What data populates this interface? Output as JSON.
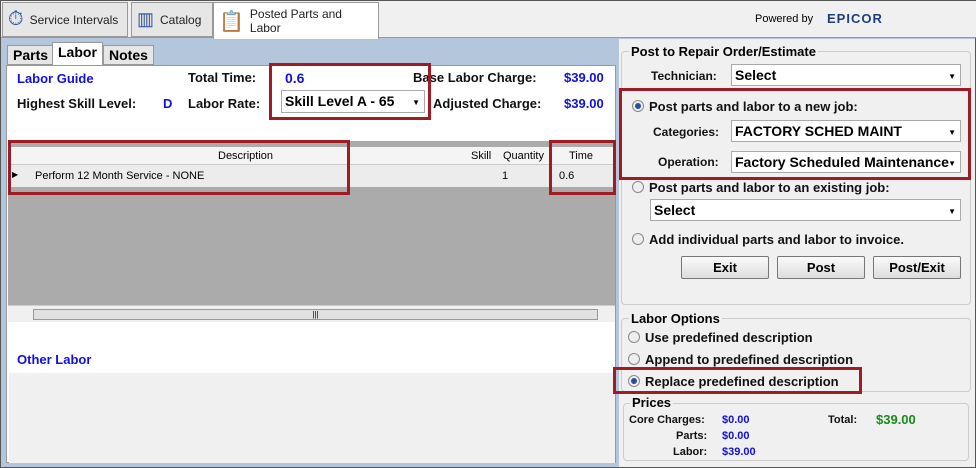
{
  "top_tabs": [
    {
      "label": "Service Intervals",
      "icon": "wrench-clock-icon"
    },
    {
      "label": "Catalog",
      "icon": "binders-icon"
    },
    {
      "label": "Posted Parts and Labor",
      "icon": "clipboard-icon"
    }
  ],
  "powered_by": "Powered by",
  "brand": "EPICOR",
  "sub_tabs": [
    "Parts",
    "Labor",
    "Notes"
  ],
  "labor": {
    "labor_guide": "Labor Guide",
    "total_time_label": "Total Time:",
    "total_time": "0.6",
    "base_charge_label": "Base Labor Charge:",
    "base_charge": "$39.00",
    "highest_skill_label": "Highest Skill Level:",
    "highest_skill": "D",
    "labor_rate_label": "Labor Rate:",
    "labor_rate": "Skill Level A - 65",
    "adjusted_label": "Adjusted Charge:",
    "adjusted": "$39.00"
  },
  "grid": {
    "columns": [
      "Description",
      "Skill",
      "Quantity",
      "Time"
    ],
    "rows": [
      {
        "description": "Perform 12 Month Service - NONE",
        "skill": "",
        "quantity": "1",
        "time": "0.6"
      }
    ]
  },
  "other_labor": "Other Labor",
  "post": {
    "title": "Post to Repair Order/Estimate",
    "technician_label": "Technician:",
    "technician": "Select",
    "new_job": "Post parts and labor to a new job:",
    "categories_label": "Categories:",
    "categories": "FACTORY SCHED MAINT",
    "operation_label": "Operation:",
    "operation": "Factory Scheduled Maintenance",
    "existing_job": "Post parts and labor to an existing job:",
    "existing_select": "Select",
    "individual": "Add individual parts and labor to invoice.",
    "exit": "Exit",
    "post": "Post",
    "post_exit": "Post/Exit"
  },
  "labor_options": {
    "title": "Labor Options",
    "options": [
      "Use predefined description",
      "Append to predefined description",
      "Replace predefined description"
    ],
    "selected": 2
  },
  "prices": {
    "title": "Prices",
    "core_label": "Core Charges:",
    "core": "$0.00",
    "parts_label": "Parts:",
    "parts": "$0.00",
    "labor_label": "Labor:",
    "labor": "$39.00",
    "total_label": "Total:",
    "total": "$39.00"
  },
  "colors": {
    "value_blue": "#1010e0",
    "total_green": "#1a8a1a",
    "highlight_red": "#a01c24"
  }
}
